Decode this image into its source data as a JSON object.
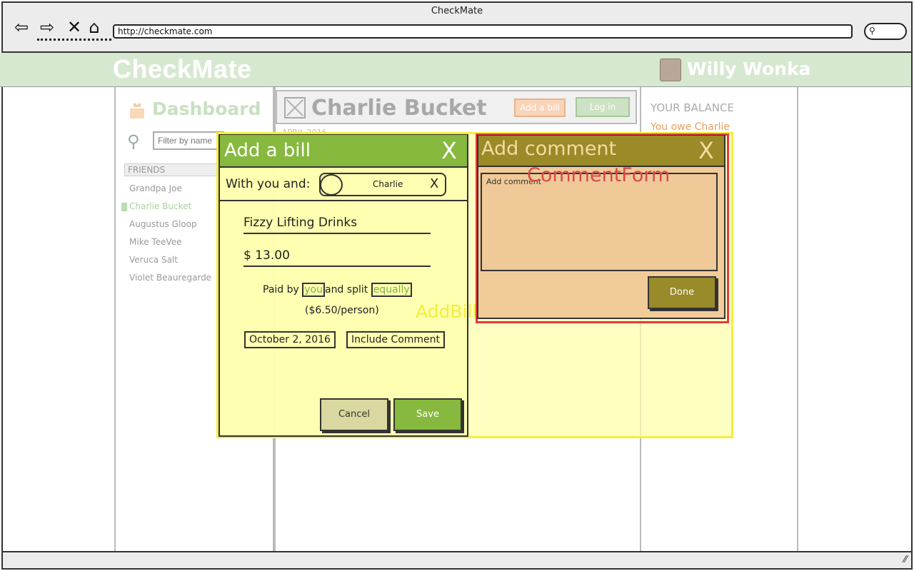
{
  "window": {
    "title": "CheckMate"
  },
  "browser": {
    "url": "http://checkmate.com",
    "back_icon": "back-arrow-icon",
    "forward_icon": "forward-arrow-icon",
    "stop_icon": "close-icon",
    "home_icon": "home-icon",
    "search_icon": "search-icon"
  },
  "header": {
    "brand": "CheckMate",
    "user_name": "Willy Wonka"
  },
  "sidebar": {
    "title": "Dashboard",
    "filter_placeholder": "Filter by name",
    "friends_heading": "FRIENDS",
    "friends": [
      {
        "name": "Grandpa Joe"
      },
      {
        "name": "Charlie Bucket"
      },
      {
        "name": "Augustus Gloop"
      },
      {
        "name": "Mike TeeVee"
      },
      {
        "name": "Veruca Salt"
      },
      {
        "name": "Violet Beauregarde"
      }
    ]
  },
  "main": {
    "title": "Charlie Bucket",
    "add_bill_label": "Add a bill",
    "login_label": "Log in",
    "date_header": "APRIL 2016"
  },
  "balance": {
    "label": "YOUR BALANCE",
    "text": "You owe Charlie"
  },
  "add_bill": {
    "title": "Add a bill",
    "close": "X",
    "with_label": "With you and:",
    "with_name": "Charlie",
    "with_remove": "X",
    "description": "Fizzy Lifting Drinks",
    "amount": "$ 13.00",
    "paid_by_prefix": "Paid by",
    "paid_by_value": "you",
    "split_prefix": "and split",
    "split_value": "equally",
    "per_person": "($6.50/person)",
    "date": "October 2, 2016",
    "include_comment": "Include Comment",
    "cancel": "Cancel",
    "save": "Save",
    "annotation": "AddBillForm"
  },
  "add_comment": {
    "title": "Add comment",
    "close": "X",
    "placeholder": "Add comment",
    "done": "Done",
    "annotation": "CommentForm"
  },
  "colors": {
    "brand_green": "#86b93e",
    "comment_olive": "#9a8a28",
    "comment_bg": "#f2cc98",
    "highlight_yellow": "#f5ee3c",
    "highlight_red": "#e23c3c"
  }
}
